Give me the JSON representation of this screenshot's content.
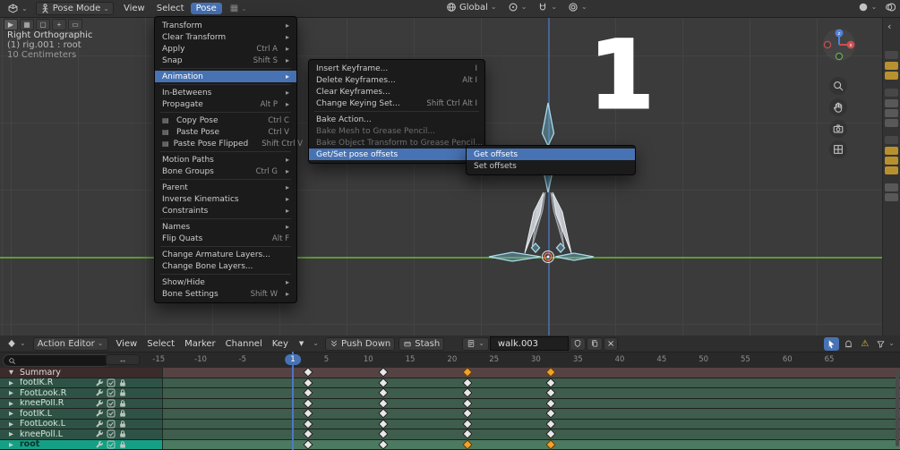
{
  "topbar": {
    "mode_label": "Pose Mode",
    "menus": [
      {
        "label": "View"
      },
      {
        "label": "Select"
      },
      {
        "label": "Pose",
        "active": true
      }
    ],
    "orientation_label": "Global"
  },
  "viewport": {
    "overlay": {
      "view_label": "Right Orthographic",
      "object_label": "(1) rig.001 : root",
      "scale_label": "10 Centimeters"
    },
    "annotation_digit": "1"
  },
  "pose_menu": {
    "items": [
      {
        "label": "Transform",
        "submenu": true
      },
      {
        "label": "Clear Transform",
        "submenu": true
      },
      {
        "label": "Apply",
        "shortcut": "Ctrl A",
        "submenu": true
      },
      {
        "label": "Snap",
        "shortcut": "Shift S",
        "submenu": true
      },
      {
        "separator": true
      },
      {
        "label": "Animation",
        "submenu": true,
        "highlighted": true
      },
      {
        "separator": true
      },
      {
        "label": "In-Betweens",
        "submenu": true
      },
      {
        "label": "Propagate",
        "shortcut": "Alt P",
        "submenu": true
      },
      {
        "separator": true
      },
      {
        "label": "Copy Pose",
        "shortcut": "Ctrl C",
        "icon": "copy-icon"
      },
      {
        "label": "Paste Pose",
        "shortcut": "Ctrl V",
        "icon": "paste-icon"
      },
      {
        "label": "Paste Pose Flipped",
        "shortcut": "Shift Ctrl V",
        "icon": "paste-flipped-icon"
      },
      {
        "separator": true
      },
      {
        "label": "Motion Paths",
        "submenu": true
      },
      {
        "label": "Bone Groups",
        "shortcut": "Ctrl G",
        "submenu": true
      },
      {
        "separator": true
      },
      {
        "label": "Parent",
        "submenu": true
      },
      {
        "label": "Inverse Kinematics",
        "submenu": true
      },
      {
        "label": "Constraints",
        "submenu": true
      },
      {
        "separator": true
      },
      {
        "label": "Names",
        "submenu": true
      },
      {
        "label": "Flip Quats",
        "shortcut": "Alt F"
      },
      {
        "separator": true
      },
      {
        "label": "Change Armature Layers..."
      },
      {
        "label": "Change Bone Layers..."
      },
      {
        "separator": true
      },
      {
        "label": "Show/Hide",
        "submenu": true
      },
      {
        "label": "Bone Settings",
        "shortcut": "Shift W",
        "submenu": true
      }
    ]
  },
  "animation_menu": {
    "items": [
      {
        "label": "Insert Keyframe...",
        "shortcut": "I"
      },
      {
        "label": "Delete Keyframes...",
        "shortcut": "Alt I"
      },
      {
        "label": "Clear Keyframes..."
      },
      {
        "label": "Change Keying Set...",
        "shortcut": "Shift Ctrl Alt I"
      },
      {
        "separator": true
      },
      {
        "label": "Bake Action..."
      },
      {
        "label": "Bake Mesh to Grease Pencil...",
        "disabled": true
      },
      {
        "label": "Bake Object Transform to Grease Pencil...",
        "disabled": true
      },
      {
        "label": "Get/Set pose offsets",
        "submenu": true,
        "highlighted": true
      }
    ]
  },
  "getset_menu": {
    "items": [
      {
        "label": "Get offsets",
        "highlighted": true
      },
      {
        "label": "Set offsets"
      }
    ]
  },
  "dope_sheet": {
    "header": {
      "editor_label": "Action Editor",
      "menus": [
        "View",
        "Select",
        "Marker",
        "Channel",
        "Key"
      ],
      "push_down_label": "Push Down",
      "stash_label": "Stash",
      "action_name": "walk.003"
    },
    "ruler": {
      "labels": [
        -15,
        -10,
        -5,
        1,
        5,
        10,
        15,
        20,
        25,
        30,
        35,
        40,
        45,
        50,
        55,
        60,
        65
      ],
      "current_frame": 1
    },
    "key_frames": [
      1,
      10,
      20,
      30
    ],
    "channels": [
      {
        "name": "Summary",
        "type": "summary",
        "expanded": true,
        "selected_keys": [
          20,
          30
        ]
      },
      {
        "name": "footIK.R",
        "type": "bone",
        "selected_keys": []
      },
      {
        "name": "FootLook.R",
        "type": "bone",
        "selected_keys": []
      },
      {
        "name": "kneePoll.R",
        "type": "bone",
        "selected_keys": []
      },
      {
        "name": "footIK.L",
        "type": "bone",
        "selected_keys": []
      },
      {
        "name": "FootLook.L",
        "type": "bone",
        "selected_keys": []
      },
      {
        "name": "kneePoll.L",
        "type": "bone",
        "selected_keys": []
      },
      {
        "name": "root",
        "type": "bone",
        "selected": true,
        "selected_keys": [
          20,
          30
        ]
      }
    ]
  },
  "colors": {
    "accent_blue": "#4772b3",
    "keyframe_selected": "#f0a12e",
    "keyframe_normal": "#e8e8e8",
    "channel_green": "#3e5d4c",
    "summary_red": "#564242",
    "root_selected_teal": "#14a085",
    "axis_y_green": "#63a436",
    "axis_z_blue": "#49679e",
    "annotation_white": "#ffffff"
  }
}
